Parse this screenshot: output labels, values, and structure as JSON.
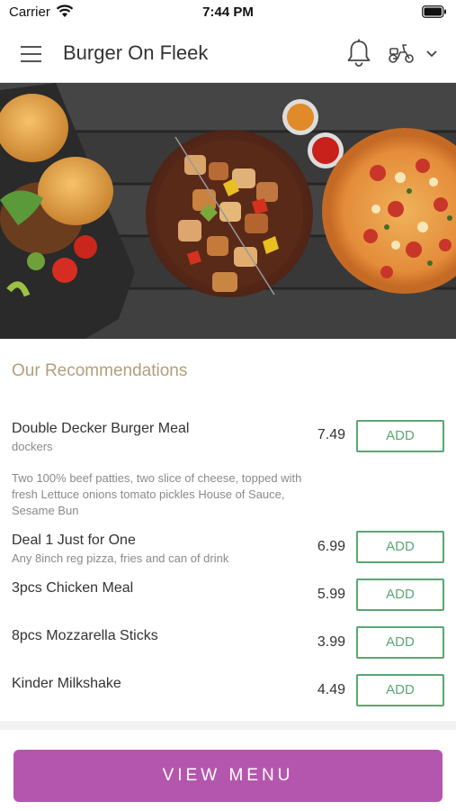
{
  "status_bar": {
    "carrier": "Carrier",
    "time": "7:44 PM"
  },
  "header": {
    "title": "Burger On Fleek"
  },
  "recommendations": {
    "title": "Our Recommendations",
    "items": [
      {
        "name": "Double Decker Burger Meal",
        "subtitle": "dockers",
        "description": "Two 100% beef patties, two slice of cheese, topped with fresh Lettuce onions tomato pickles House of Sauce, Sesame  Bun",
        "price": "7.49",
        "add_label": "ADD"
      },
      {
        "name": "Deal 1 Just for One",
        "subtitle": "Any 8inch reg pizza, fries and can of drink",
        "description": "",
        "price": "6.99",
        "add_label": "ADD"
      },
      {
        "name": "3pcs Chicken Meal",
        "subtitle": "",
        "description": "",
        "price": "5.99",
        "add_label": "ADD"
      },
      {
        "name": "8pcs Mozzarella Sticks",
        "subtitle": "",
        "description": "",
        "price": "3.99",
        "add_label": "ADD"
      },
      {
        "name": "Kinder Milkshake",
        "subtitle": "",
        "description": "",
        "price": "4.49",
        "add_label": "ADD"
      }
    ]
  },
  "footer": {
    "view_menu_label": "VIEW MENU"
  },
  "colors": {
    "accent": "#b556ae",
    "add_green": "#5ba672",
    "section_title": "#b29e7a"
  },
  "icons": {
    "menu": "hamburger-menu-icon",
    "notification": "bell-icon",
    "delivery": "scooter-icon",
    "dropdown": "chevron-down-icon"
  }
}
